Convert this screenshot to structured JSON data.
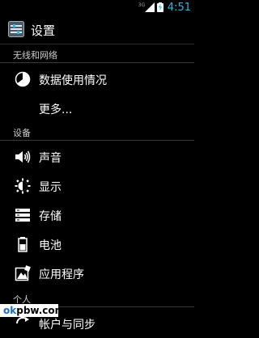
{
  "status_bar": {
    "network": "3G",
    "time": "4:51",
    "accent": "#33b5e5"
  },
  "action_bar": {
    "title": "设置",
    "icon": "settings-app-icon"
  },
  "sections": [
    {
      "header": "无线和网络",
      "items": [
        {
          "label": "数据使用情况",
          "icon": "data-usage-icon"
        },
        {
          "label": "更多...",
          "icon": ""
        }
      ]
    },
    {
      "header": "设备",
      "items": [
        {
          "label": "声音",
          "icon": "sound-icon"
        },
        {
          "label": "显示",
          "icon": "display-icon"
        },
        {
          "label": "存储",
          "icon": "storage-icon"
        },
        {
          "label": "电池",
          "icon": "battery-icon"
        },
        {
          "label": "应用程序",
          "icon": "apps-icon"
        }
      ]
    },
    {
      "header": "个人",
      "items": [
        {
          "label": "帐户与同步",
          "icon": "account-sync-icon"
        }
      ]
    }
  ],
  "watermark": {
    "part1": "ok",
    "part2": "pbw.com"
  }
}
